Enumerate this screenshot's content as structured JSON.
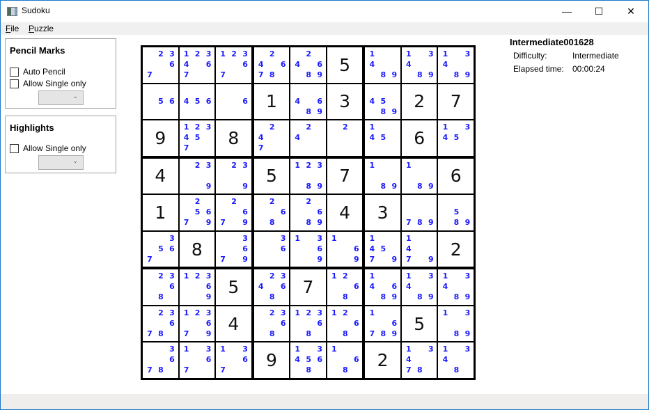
{
  "window": {
    "title": "Sudoku",
    "controls": {
      "minimize": "—",
      "maximize": "☐",
      "close": "✕"
    }
  },
  "menu": [
    {
      "label": "File",
      "accel": "F",
      "rest": "ile"
    },
    {
      "label": "Puzzle",
      "accel": "P",
      "rest": "uzzle"
    }
  ],
  "pencil_marks": {
    "title": "Pencil Marks",
    "auto_pencil": {
      "label": "Auto Pencil",
      "checked": false
    },
    "allow_single_only": {
      "label": "Allow Single only",
      "checked": false
    },
    "dropdown_value": "",
    "dropdown_arrow": "⌄"
  },
  "highlights": {
    "title": "Highlights",
    "allow_single_only": {
      "label": "Allow Single only",
      "checked": false
    },
    "dropdown_value": "",
    "dropdown_arrow": "⌄"
  },
  "puzzle_info": {
    "name": "Intermediate001628",
    "difficulty_label": "Difficulty:",
    "difficulty_value": "Intermediate",
    "elapsed_label": "Elapsed time:",
    "elapsed_value": "00:00:24"
  },
  "colors": {
    "pencil_mark": "#1a1aff",
    "given_digit": "#111111",
    "grid_line": "#000000",
    "window_border": "#1979ca"
  },
  "board": {
    "givens": [
      [
        0,
        0,
        0,
        0,
        0,
        5,
        0,
        0,
        0
      ],
      [
        0,
        0,
        0,
        1,
        0,
        3,
        0,
        2,
        7
      ],
      [
        9,
        0,
        8,
        0,
        0,
        0,
        0,
        6,
        0
      ],
      [
        4,
        0,
        0,
        5,
        0,
        7,
        0,
        0,
        6
      ],
      [
        1,
        0,
        0,
        0,
        0,
        4,
        3,
        0,
        0
      ],
      [
        0,
        8,
        0,
        0,
        0,
        0,
        0,
        0,
        2
      ],
      [
        0,
        0,
        5,
        0,
        7,
        0,
        0,
        0,
        0
      ],
      [
        0,
        0,
        4,
        0,
        0,
        0,
        0,
        5,
        0
      ],
      [
        0,
        0,
        0,
        9,
        0,
        0,
        2,
        0,
        0
      ]
    ],
    "pencil": [
      [
        [
          2,
          3,
          6,
          7
        ],
        [
          1,
          2,
          3,
          4,
          6,
          7
        ],
        [
          1,
          2,
          3,
          6,
          7
        ],
        [
          2,
          4,
          6,
          7,
          8
        ],
        [
          2,
          4,
          6,
          8,
          9
        ],
        [],
        [
          1,
          4,
          8,
          9
        ],
        [
          1,
          3,
          4,
          8,
          9
        ],
        [
          1,
          3,
          4,
          8,
          9
        ]
      ],
      [
        [
          5,
          6
        ],
        [
          4,
          5,
          6
        ],
        [
          6
        ],
        [],
        [
          4,
          6,
          8,
          9
        ],
        [],
        [
          4,
          5,
          8,
          9
        ],
        [],
        []
      ],
      [
        [],
        [
          1,
          2,
          3,
          4,
          5,
          7
        ],
        [],
        [
          2,
          4,
          7
        ],
        [
          2,
          4
        ],
        [
          2
        ],
        [
          1,
          4,
          5
        ],
        [],
        [
          1,
          3,
          4,
          5
        ]
      ],
      [
        [],
        [
          2,
          3,
          9
        ],
        [
          2,
          3,
          9
        ],
        [],
        [
          1,
          2,
          3,
          8,
          9
        ],
        [],
        [
          1,
          8,
          9
        ],
        [
          1,
          8,
          9
        ],
        []
      ],
      [
        [],
        [
          2,
          5,
          6,
          7,
          9
        ],
        [
          2,
          6,
          7,
          9
        ],
        [
          2,
          6,
          8
        ],
        [
          2,
          6,
          8,
          9
        ],
        [],
        [],
        [
          7,
          8,
          9
        ],
        [
          5,
          8,
          9
        ]
      ],
      [
        [
          3,
          5,
          6,
          7
        ],
        [],
        [
          3,
          6,
          7,
          9
        ],
        [
          3,
          6
        ],
        [
          1,
          3,
          6,
          9
        ],
        [
          1,
          6,
          9
        ],
        [
          1,
          4,
          5,
          7,
          9
        ],
        [
          1,
          4,
          7,
          9
        ],
        []
      ],
      [
        [
          2,
          3,
          6,
          8
        ],
        [
          1,
          2,
          3,
          6,
          9
        ],
        [],
        [
          2,
          3,
          4,
          6,
          8
        ],
        [],
        [
          1,
          2,
          6,
          8
        ],
        [
          1,
          4,
          6,
          8,
          9
        ],
        [
          1,
          3,
          4,
          8,
          9
        ],
        [
          1,
          3,
          4,
          8,
          9
        ]
      ],
      [
        [
          2,
          3,
          6,
          7,
          8
        ],
        [
          1,
          2,
          3,
          6,
          7,
          9
        ],
        [],
        [
          2,
          3,
          6,
          8
        ],
        [
          1,
          2,
          3,
          6,
          8
        ],
        [
          1,
          2,
          6,
          8
        ],
        [
          1,
          6,
          7,
          8,
          9
        ],
        [],
        [
          1,
          3,
          8,
          9
        ]
      ],
      [
        [
          3,
          6,
          7,
          8
        ],
        [
          1,
          3,
          6,
          7
        ],
        [
          1,
          3,
          6,
          7
        ],
        [],
        [
          1,
          3,
          4,
          5,
          6,
          8
        ],
        [
          1,
          6,
          8
        ],
        [],
        [
          1,
          3,
          4,
          7,
          8
        ],
        [
          1,
          3,
          4,
          8
        ]
      ]
    ]
  }
}
